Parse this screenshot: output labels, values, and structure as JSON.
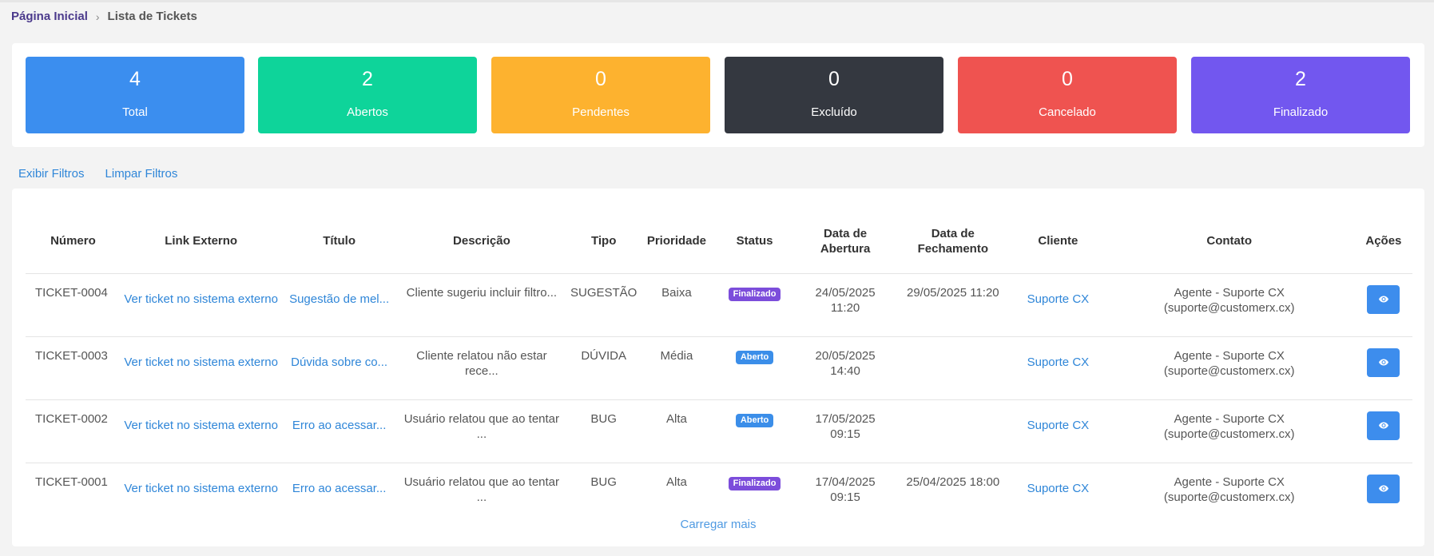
{
  "breadcrumb": {
    "home": "Página Inicial",
    "separator": "›",
    "current": "Lista de Tickets"
  },
  "stats": [
    {
      "value": "4",
      "label": "Total",
      "color": "#3b8eef"
    },
    {
      "value": "2",
      "label": "Abertos",
      "color": "#0ed49a"
    },
    {
      "value": "0",
      "label": "Pendentes",
      "color": "#fdb22f"
    },
    {
      "value": "0",
      "label": "Excluído",
      "color": "#343840"
    },
    {
      "value": "0",
      "label": "Cancelado",
      "color": "#ef5350"
    },
    {
      "value": "2",
      "label": "Finalizado",
      "color": "#7257ef"
    }
  ],
  "filters": {
    "show": "Exibir Filtros",
    "clear": "Limpar Filtros"
  },
  "table": {
    "headers": {
      "numero": "Número",
      "link": "Link Externo",
      "titulo": "Título",
      "descricao": "Descrição",
      "tipo": "Tipo",
      "prioridade": "Prioridade",
      "status": "Status",
      "abertura": "Data de Abertura",
      "fechamento": "Data de Fechamento",
      "cliente": "Cliente",
      "contato": "Contato",
      "acoes": "Ações"
    },
    "rows": [
      {
        "numero": "TICKET-0004",
        "link": "Ver ticket no sistema externo",
        "titulo": "Sugestão de mel...",
        "descricao": "Cliente sugeriu incluir filtro...",
        "tipo": "SUGESTÃO",
        "prioridade": "Baixa",
        "status": "Finalizado",
        "abertura": "24/05/2025 11:20",
        "fechamento": "29/05/2025 11:20",
        "cliente": "Suporte CX",
        "contato": "Agente - Suporte CX (suporte@customerx.cx)"
      },
      {
        "numero": "TICKET-0003",
        "link": "Ver ticket no sistema externo",
        "titulo": "Dúvida sobre co...",
        "descricao": "Cliente relatou não estar rece...",
        "tipo": "DÚVIDA",
        "prioridade": "Média",
        "status": "Aberto",
        "abertura": "20/05/2025 14:40",
        "fechamento": "",
        "cliente": "Suporte CX",
        "contato": "Agente - Suporte CX (suporte@customerx.cx)"
      },
      {
        "numero": "TICKET-0002",
        "link": "Ver ticket no sistema externo",
        "titulo": "Erro ao acessar...",
        "descricao": "Usuário relatou que ao tentar ...",
        "tipo": "BUG",
        "prioridade": "Alta",
        "status": "Aberto",
        "abertura": "17/05/2025 09:15",
        "fechamento": "",
        "cliente": "Suporte CX",
        "contato": "Agente - Suporte CX (suporte@customerx.cx)"
      },
      {
        "numero": "TICKET-0001",
        "link": "Ver ticket no sistema externo",
        "titulo": "Erro ao acessar...",
        "descricao": "Usuário relatou que ao tentar ...",
        "tipo": "BUG",
        "prioridade": "Alta",
        "status": "Finalizado",
        "abertura": "17/04/2025 09:15",
        "fechamento": "25/04/2025 18:00",
        "cliente": "Suporte CX",
        "contato": "Agente - Suporte CX (suporte@customerx.cx)"
      }
    ],
    "action_icon": "eye-icon",
    "load_more": "Carregar mais"
  }
}
